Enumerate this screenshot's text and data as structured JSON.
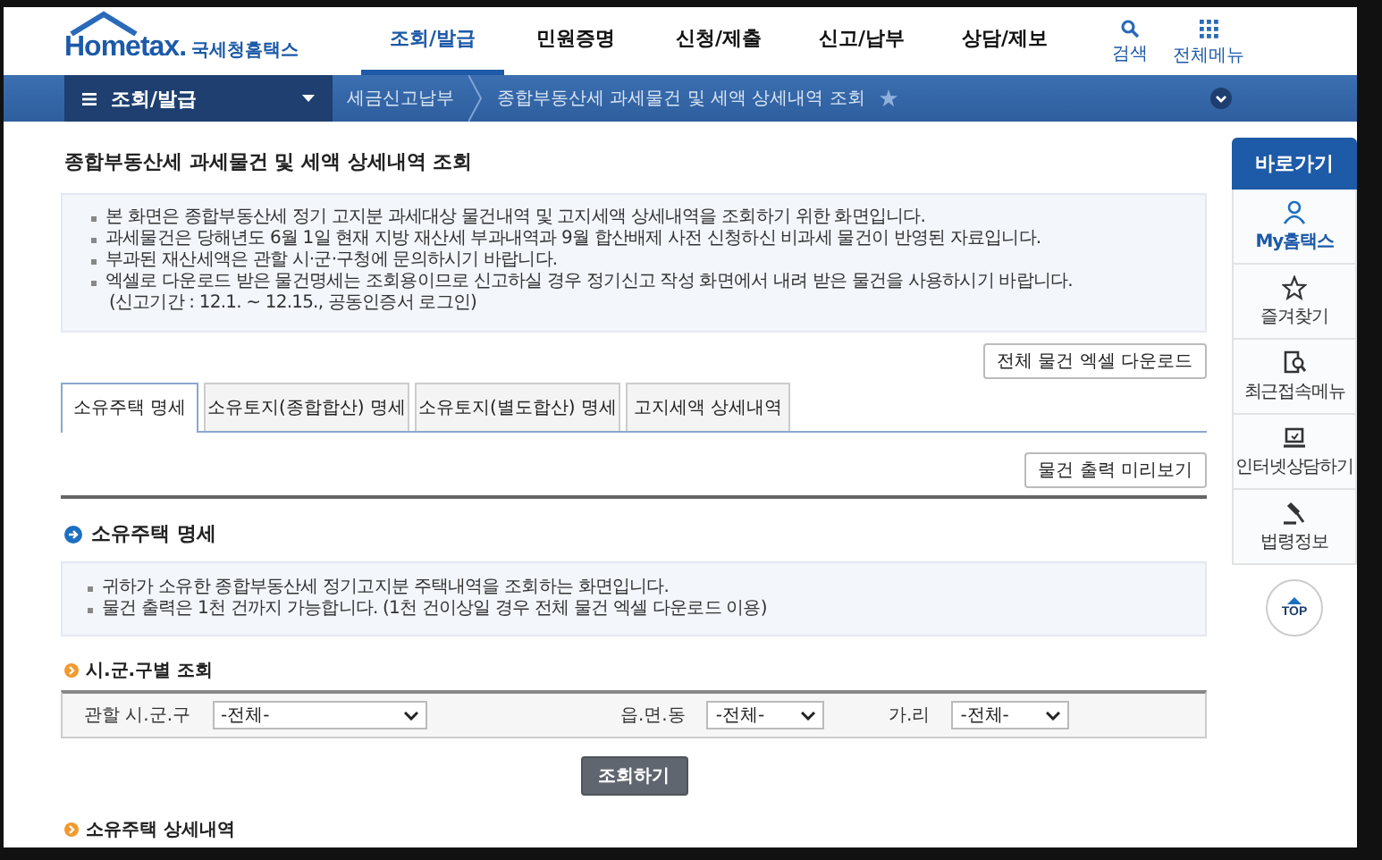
{
  "header": {
    "logo": {
      "brand": "Hometax.",
      "org": "국세청홈택스"
    },
    "nav": [
      {
        "label": "조회/발급",
        "selected": true
      },
      {
        "label": "민원증명",
        "selected": false
      },
      {
        "label": "신청/제출",
        "selected": false
      },
      {
        "label": "신고/납부",
        "selected": false
      },
      {
        "label": "상담/제보",
        "selected": false
      }
    ],
    "tools": [
      {
        "kind": "search",
        "label": "검색"
      },
      {
        "kind": "grid",
        "label": "전체메뉴"
      }
    ]
  },
  "subnav": {
    "menu": "조회/발급",
    "breadcrumbs": [
      "세금신고납부",
      "종합부동산세 과세물건 및 세액 상세내역 조회"
    ]
  },
  "page_title": "종합부동산세 과세물건 및 세액 상세내역 조회",
  "notice": {
    "bullets": [
      "본 화면은 종합부동산세 정기 고지분 과세대상 물건내역 및 고지세액 상세내역을 조회하기 위한 화면입니다.",
      "과세물건은 당해년도 6월 1일 현재 지방 재산세 부과내역과 9월 합산배제 사전 신청하신 비과세 물건이 반영된 자료입니다.",
      "부과된 재산세액은 관할 시·군·구청에 문의하시기 바랍니다.",
      "엑셀로 다운로드 받은 물건명세는 조회용이므로 신고하실 경우 정기신고 작성 화면에서 내려 받은 물건을 사용하시기 바랍니다."
    ],
    "note": "(신고기간 : 12.1. ~ 12.15., 공동인증서 로그인)"
  },
  "download_button": "전체 물건 엑셀 다운로드",
  "tabs": [
    {
      "label": "소유주택 명세",
      "selected": true
    },
    {
      "label": "소유토지(종합합산) 명세",
      "selected": false
    },
    {
      "label": "소유토지(별도합산) 명세",
      "selected": false
    },
    {
      "label": "고지세액 상세내역",
      "selected": false
    }
  ],
  "preview_button": "물건 출력 미리보기",
  "section": {
    "title": "소유주택 명세",
    "bullets": [
      "귀하가 소유한 종합부동산세 정기고지분 주택내역을 조회하는 화면입니다.",
      "물건 출력은 1천 건까지 가능합니다. (1천 건이상일 경우 전체 물건 엑셀 다운로드 이용)"
    ]
  },
  "filter": {
    "title": "시.군.구별 조회",
    "fields": [
      {
        "label": "관할 시.군.구",
        "value": "-전체-"
      },
      {
        "label": "읍.면.동",
        "value": "-전체-"
      },
      {
        "label": "가.리",
        "value": "-전체-"
      }
    ],
    "button": "조회하기"
  },
  "detail_title": "소유주택 상세내역",
  "sidebar": {
    "title": "바로가기",
    "items": [
      {
        "kind": "person",
        "label": "My홈택스",
        "selected": true
      },
      {
        "kind": "star",
        "label": "즐겨찾기",
        "selected": false
      },
      {
        "kind": "doc-search",
        "label": "최근접속메뉴",
        "selected": false
      },
      {
        "kind": "laptop",
        "label": "인터넷상담하기",
        "selected": false
      },
      {
        "kind": "gavel",
        "label": "법령정보",
        "selected": false
      }
    ],
    "top": "TOP"
  }
}
